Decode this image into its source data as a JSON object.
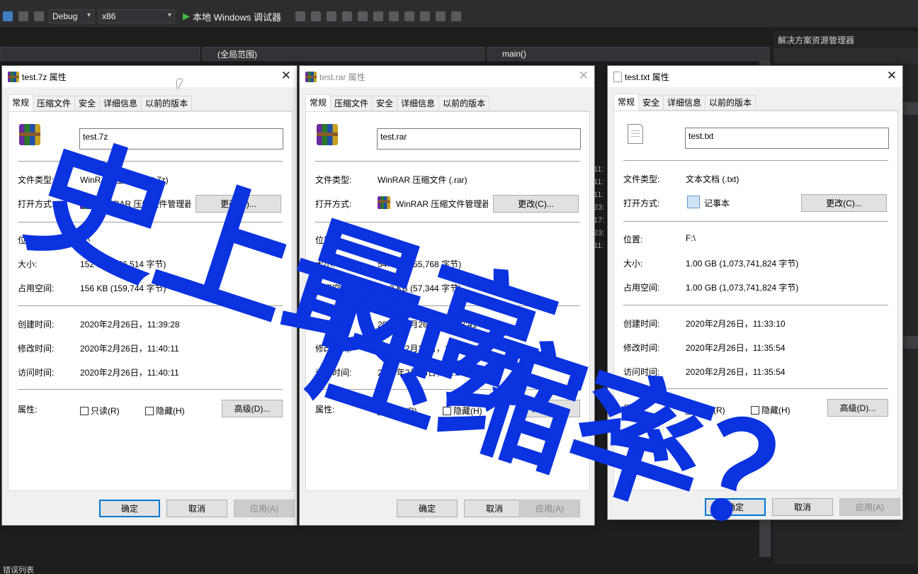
{
  "ide": {
    "config": "Debug",
    "platform": "x86",
    "run_label": "本地 Windows 调试器",
    "scope": "(全局范围)",
    "function": "main()",
    "solution_explorer_title": "解决方案资源管理器",
    "status_text": "错误列表",
    "editor_line_nums": [
      "11:",
      "11:",
      "11:",
      "23:",
      "17:",
      "23:",
      "11:"
    ]
  },
  "dialogs": [
    {
      "title": "test.7z 属性",
      "active": true,
      "icon": "winrar-icon",
      "tabs": [
        "常规",
        "压缩文件",
        "安全",
        "详细信息",
        "以前的版本"
      ],
      "filename": "test.7z",
      "type_label": "文件类型:",
      "type_value": "WinRAR 压缩文件 (.7z)",
      "open_label": "打开方式:",
      "open_value": "WinRAR 压缩文件管理器",
      "change_button": "更改(C)...",
      "location_label": "位置:",
      "location_value": "F:\\",
      "size_label": "大小:",
      "size_value": "152 KB (156,514 字节)",
      "disk_label": "占用空间:",
      "disk_value": "156 KB (159,744 字节)",
      "created_label": "创建时间:",
      "created_value": "2020年2月26日，11:39:28",
      "modified_label": "修改时间:",
      "modified_value": "2020年2月26日，11:40:11",
      "accessed_label": "访问时间:",
      "accessed_value": "2020年2月26日，11:40:11",
      "attr_label": "属性:",
      "readonly": "只读(R)",
      "hidden": "隐藏(H)",
      "advanced": "高级(D)...",
      "ok": "确定",
      "cancel": "取消",
      "apply": "应用(A)"
    },
    {
      "title": "test.rar 属性",
      "active": false,
      "icon": "winrar-icon",
      "tabs": [
        "常规",
        "压缩文件",
        "安全",
        "详细信息",
        "以前的版本"
      ],
      "filename": "test.rar",
      "type_label": "文件类型:",
      "type_value": "WinRAR 压缩文件 (.rar)",
      "open_label": "打开方式:",
      "open_value": "WinRAR 压缩文件管理器",
      "change_button": "更改(C)...",
      "location_label": "位置:",
      "location_value": "F:\\",
      "size_label": "大小:",
      "size_value": "54.4 KB (55,768 字节)",
      "disk_label": "占用空间:",
      "disk_value": "56.0 KB (57,344 字节)",
      "created_label": "创建时间:",
      "created_value": "2020年2月26日，11:38:41",
      "modified_label": "修改时间:",
      "modified_value": "2020年2月26日，11:39:05",
      "accessed_label": "访问时间:",
      "accessed_value": "2020年2月26日，11:39:05",
      "attr_label": "属性:",
      "readonly": "只读(R)",
      "hidden": "隐藏(H)",
      "advanced": "高级(D)...",
      "ok": "确定",
      "cancel": "取消",
      "apply": "应用(A)"
    },
    {
      "title": "test.txt 属性",
      "active": true,
      "icon": "text-file-icon",
      "tabs": [
        "常规",
        "安全",
        "详细信息",
        "以前的版本"
      ],
      "filename": "test.txt",
      "type_label": "文件类型:",
      "type_value": "文本文档 (.txt)",
      "open_label": "打开方式:",
      "open_value": "记事本",
      "change_button": "更改(C)...",
      "location_label": "位置:",
      "location_value": "F:\\",
      "size_label": "大小:",
      "size_value": "1.00 GB (1,073,741,824 字节)",
      "disk_label": "占用空间:",
      "disk_value": "1.00 GB (1,073,741,824 字节)",
      "created_label": "创建时间:",
      "created_value": "2020年2月26日，11:33:10",
      "modified_label": "修改时间:",
      "modified_value": "2020年2月26日，11:35:54",
      "accessed_label": "访问时间:",
      "accessed_value": "2020年2月26日，11:35:54",
      "attr_label": "属性:",
      "readonly": "只读(R)",
      "hidden": "隐藏(H)",
      "advanced": "高级(D)...",
      "ok": "确定",
      "cancel": "取消",
      "apply": "应用(A)"
    }
  ],
  "overlay": {
    "line1": "史上最高",
    "line2": "压缩率？",
    "color": "#0b33e0"
  }
}
